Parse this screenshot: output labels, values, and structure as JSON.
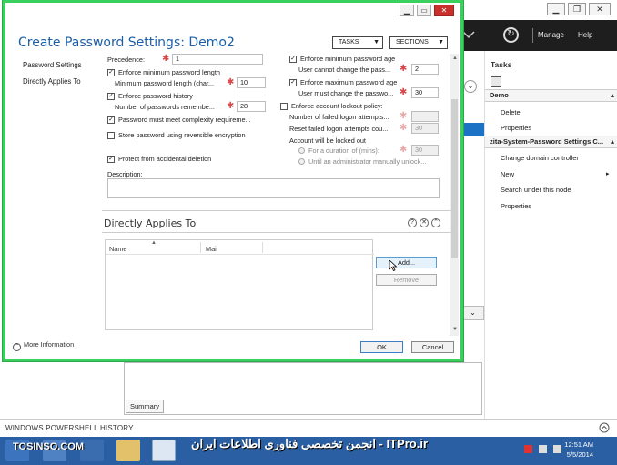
{
  "adac": {
    "header_links": {
      "manage": "Manage",
      "help": "Help"
    },
    "tasks": {
      "title": "Tasks",
      "section1": "Demo",
      "section1_items": [
        "Delete",
        "Properties"
      ],
      "section2": "zita-System-Password Settings C...",
      "section2_items": [
        "Change domain controller",
        "New",
        "Search under this node",
        "Properties"
      ]
    },
    "summary_tab": "Summary",
    "powershell_history": "WINDOWS POWERSHELL HISTORY"
  },
  "taskbar": {
    "brand": "TOSINSO.COM",
    "watermark": "انجمن تخصصی فناوری اطلاعات ایران - ITPro.ir",
    "time": "12:51 AM",
    "date": "5/5/2014"
  },
  "dialog": {
    "title": "Create Password Settings: Demo2",
    "tasks_btn": "TASKS",
    "sections_btn": "SECTIONS",
    "nav": [
      "Password Settings",
      "Directly Applies To"
    ],
    "left": {
      "precedence_label": "Precedence:",
      "precedence_value": "1",
      "enforce_min_length": "Enforce minimum password length",
      "min_length_label": "Minimum password length (char...",
      "min_length_value": "10",
      "enforce_history": "Enforce password history",
      "history_label": "Number of passwords remembe...",
      "history_value": "28",
      "complexity": "Password must meet complexity requireme...",
      "reversible": "Store password using reversible encryption",
      "protect": "Protect from accidental deletion",
      "description_label": "Description:"
    },
    "right": {
      "enforce_min_age": "Enforce minimum password age",
      "min_age_label": "User cannot change the pass...",
      "min_age_value": "2",
      "enforce_max_age": "Enforce maximum password age",
      "max_age_label": "User must change the passwo...",
      "max_age_value": "30",
      "lockout_policy": "Enforce account lockout policy:",
      "failed_attempts": "Number of failed logon attempts...",
      "reset_failed": "Reset failed logon attempts cou...",
      "reset_value": "30",
      "locked_out": "Account will be locked out",
      "duration": "For a duration of (mins):",
      "duration_value": "30",
      "until_admin": "Until an administrator manually unlock..."
    },
    "applies": {
      "title": "Directly Applies To",
      "col_name": "Name",
      "col_mail": "Mail",
      "add": "Add...",
      "remove": "Remove"
    },
    "more_info": "More Information",
    "ok": "OK",
    "cancel": "Cancel"
  }
}
